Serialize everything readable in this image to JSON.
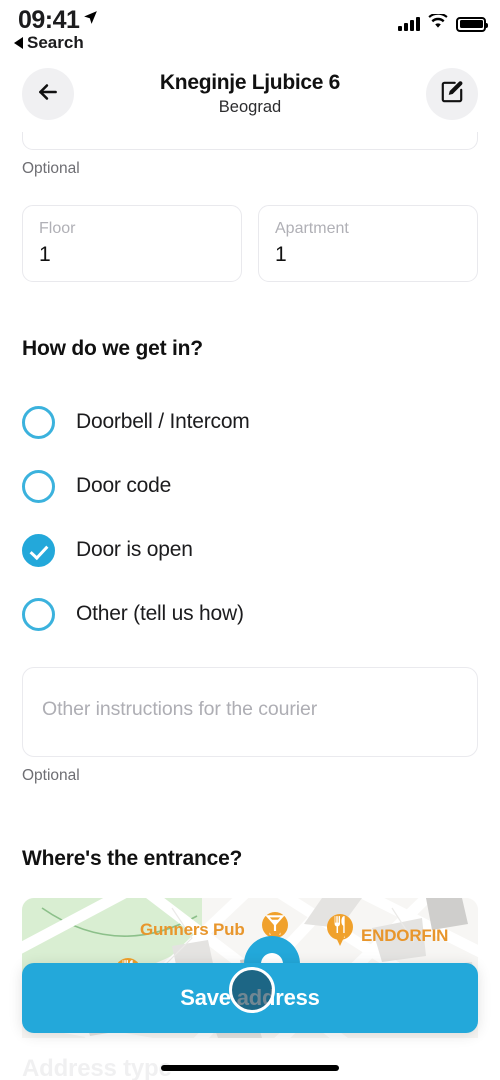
{
  "status_bar": {
    "time": "09:41",
    "location_arrow_icon": "location-arrow-icon",
    "back_app_label": "Search",
    "signal_icon": "cellular-signal-icon",
    "wifi_icon": "wifi-icon",
    "battery_icon": "battery-full-icon"
  },
  "header": {
    "back_icon": "arrow-left-icon",
    "title": "Kneginje Ljubice 6",
    "subtitle": "Beograd",
    "edit_icon": "compose-edit-icon"
  },
  "form": {
    "street_optional_hint": "Optional",
    "floor": {
      "label": "Floor",
      "value": "1"
    },
    "apartment": {
      "label": "Apartment",
      "value": "1"
    }
  },
  "access": {
    "heading": "How do we get in?",
    "options": [
      {
        "label": "Doorbell / Intercom",
        "selected": false
      },
      {
        "label": "Door code",
        "selected": false
      },
      {
        "label": "Door is open",
        "selected": true
      },
      {
        "label": "Other (tell us how)",
        "selected": false
      }
    ],
    "instructions_placeholder": "Other instructions for the courier",
    "instructions_value": "",
    "instructions_optional_hint": "Optional"
  },
  "entrance": {
    "heading": "Where's the entrance?",
    "map": {
      "pois": [
        {
          "name": "Gunners Pub",
          "icon": "cocktail-glass-icon"
        },
        {
          "name": "ENDORFIN",
          "icon": "restaurant-fork-knife-icon"
        }
      ],
      "unlabeled_poi_icon": "restaurant-fork-knife-icon",
      "marker_icon": "location-pin-icon"
    }
  },
  "footer": {
    "save_label": "Save address",
    "touch_indicator": "tap-indicator",
    "obscured_text": "Address type"
  },
  "colors": {
    "accent": "#23a8da",
    "radio_outline": "#3bb2dd",
    "poi_orange": "#e8962c",
    "border": "#e9e9ed",
    "placeholder": "#aeaeb4"
  }
}
